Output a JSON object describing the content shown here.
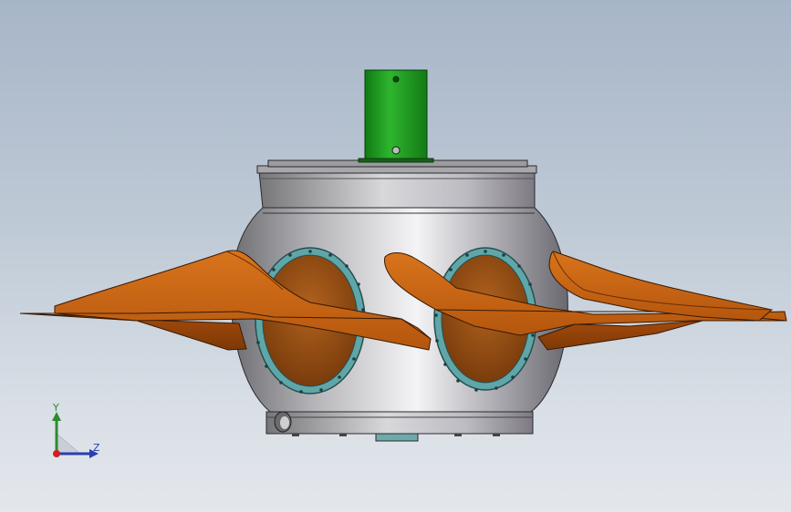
{
  "viewport": {
    "background_top": "#a7b5c8",
    "background_bottom": "#e3e7ec"
  },
  "model": {
    "hub_color": "#b9b9bd",
    "blade_color": "#c25f12",
    "shaft_color": "#1f9a1f",
    "flange_color": "#5fa6a8"
  },
  "triad": {
    "y_label": "Y",
    "z_label": "Z",
    "y_color": "#2e8b2e",
    "z_color": "#2b3fb0",
    "origin_color": "#d11f1f"
  }
}
